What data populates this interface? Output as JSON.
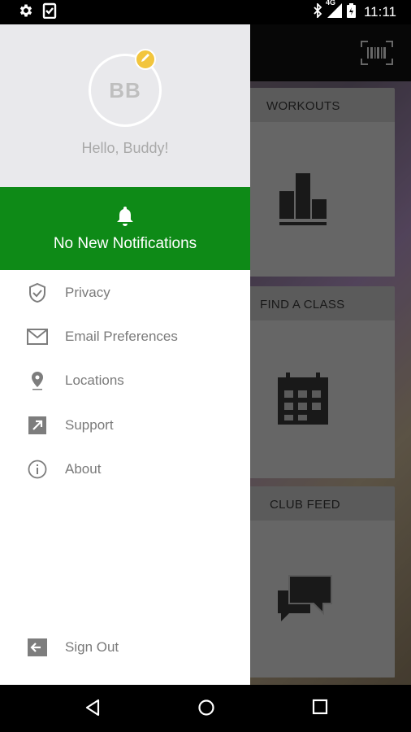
{
  "status_bar": {
    "time": "11:11",
    "network": "4G",
    "left_icons": [
      "gear-icon",
      "clipboard-check-icon"
    ],
    "right_icons": [
      "bluetooth-icon",
      "signal-icon",
      "battery-icon"
    ]
  },
  "app": {
    "cards": [
      {
        "title": "WORKOUTS",
        "icon": "bar-chart-icon"
      },
      {
        "title": "FIND A CLASS",
        "icon": "calendar-icon"
      },
      {
        "title": "CLUB FEED",
        "icon": "chat-bubbles-icon"
      }
    ],
    "barcode_icon": "barcode-scan-icon"
  },
  "drawer": {
    "avatar_initials": "BB",
    "greeting": "Hello, Buddy!",
    "notification_text": "No New Notifications",
    "menu": [
      {
        "label": "Privacy",
        "icon": "shield-check-icon"
      },
      {
        "label": "Email Preferences",
        "icon": "envelope-icon"
      },
      {
        "label": "Locations",
        "icon": "location-pin-icon"
      },
      {
        "label": "Support",
        "icon": "external-link-icon"
      },
      {
        "label": "About",
        "icon": "info-icon"
      }
    ],
    "sign_out": {
      "label": "Sign Out",
      "icon": "sign-out-icon"
    }
  },
  "colors": {
    "notification_bg": "#0e8a17",
    "profile_bg": "#e9e9ec",
    "edit_badge": "#f2c53d",
    "menu_text": "#7a7a7a"
  }
}
